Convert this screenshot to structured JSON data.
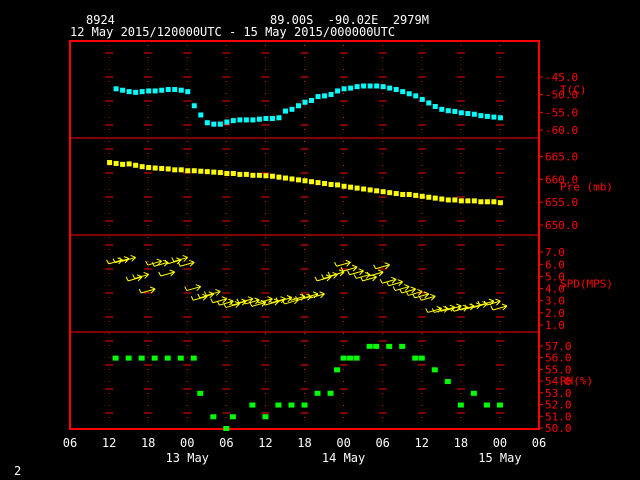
{
  "header": {
    "station": "8924",
    "location": "89.00S  -90.02E  2979M",
    "period": "12 May 2015/120000UTC - 15 May 2015/000000UTC"
  },
  "footer": {
    "page": "2"
  },
  "chart_data": {
    "type": "scatter",
    "x_hours": {
      "ticks": [
        -6,
        0,
        6,
        12,
        18,
        24,
        30,
        36,
        42,
        48,
        54,
        60,
        66,
        72,
        78
      ],
      "tick_labels": [
        "06",
        "12",
        "18",
        "00",
        "06",
        "12",
        "18",
        "00",
        "06",
        "12",
        "18",
        "00",
        "06"
      ],
      "tick_label_hours": [
        6,
        12,
        18,
        24,
        30,
        36,
        42,
        48,
        54,
        60,
        66,
        72,
        78
      ],
      "range": [
        6,
        78
      ],
      "origin_note_hidden": true
    },
    "date_labels": [
      {
        "text": "13 May",
        "hour": 24
      },
      {
        "text": "14 May",
        "hour": 48
      },
      {
        "text": "15 May",
        "hour": 72
      }
    ],
    "colors": {
      "frame": "#ff0000",
      "temp": "#00ffff",
      "pres": "#ffff00",
      "wind": "#ffff00",
      "rh": "#00ff00",
      "grid": "#ff0000",
      "text": "#ffffff"
    },
    "panels": [
      {
        "name": "T(C)",
        "label": "T(C)",
        "range": [
          -60.0,
          -45.0
        ],
        "ticks": [
          "-45.0",
          "-50.0",
          "-55.0",
          "-60.0"
        ],
        "tick_values": [
          -45,
          -50,
          -55,
          -60
        ],
        "series": {
          "hours": [
            13,
            14,
            15,
            16,
            17,
            18,
            19,
            20,
            21,
            22,
            23,
            24,
            25,
            26,
            27,
            28,
            29,
            30,
            31,
            32,
            33,
            34,
            35,
            36,
            37,
            38,
            39,
            40,
            41,
            42,
            43,
            44,
            45,
            46,
            47,
            48,
            49,
            50,
            51,
            52,
            53,
            54,
            55,
            56,
            57,
            58,
            59,
            60,
            61,
            62,
            63,
            64,
            65,
            66,
            67,
            68,
            69,
            70,
            71,
            72
          ],
          "values": [
            -48.2,
            -48.6,
            -49.0,
            -49.2,
            -49.0,
            -48.8,
            -48.8,
            -48.6,
            -48.4,
            -48.4,
            -48.6,
            -49.0,
            -53.0,
            -55.6,
            -57.8,
            -58.2,
            -58.2,
            -57.6,
            -57.2,
            -57.0,
            -57.0,
            -57.0,
            -56.8,
            -56.6,
            -56.6,
            -56.4,
            -54.5,
            -54.0,
            -53.0,
            -52.0,
            -51.5,
            -50.4,
            -50.2,
            -49.8,
            -48.8,
            -48.2,
            -48.0,
            -47.6,
            -47.4,
            -47.4,
            -47.4,
            -47.6,
            -48.0,
            -48.4,
            -49.0,
            -49.6,
            -50.2,
            -51.2,
            -52.2,
            -53.2,
            -54.0,
            -54.4,
            -54.6,
            -55.0,
            -55.2,
            -55.4,
            -55.8,
            -56.0,
            -56.2,
            -56.4
          ]
        }
      },
      {
        "name": "Pre (mb)",
        "label": "Pre (mb)",
        "range": [
          650.0,
          666.0
        ],
        "ticks": [
          "665.0",
          "660.0",
          "655.0",
          "650.0"
        ],
        "tick_values": [
          665,
          660,
          655,
          650
        ],
        "series": {
          "hours": [
            12,
            13,
            14,
            15,
            16,
            17,
            18,
            19,
            20,
            21,
            22,
            23,
            24,
            25,
            26,
            27,
            28,
            29,
            30,
            31,
            32,
            33,
            34,
            35,
            36,
            37,
            38,
            39,
            40,
            41,
            42,
            43,
            44,
            45,
            46,
            47,
            48,
            49,
            50,
            51,
            52,
            53,
            54,
            55,
            56,
            57,
            58,
            59,
            60,
            61,
            62,
            63,
            64,
            65,
            66,
            67,
            68,
            69,
            70,
            71,
            72
          ],
          "values": [
            663.8,
            663.6,
            663.4,
            663.5,
            663.2,
            662.9,
            662.7,
            662.6,
            662.5,
            662.4,
            662.2,
            662.2,
            662.0,
            662.0,
            661.9,
            661.8,
            661.7,
            661.6,
            661.4,
            661.4,
            661.2,
            661.2,
            661.0,
            661.0,
            660.9,
            660.8,
            660.6,
            660.4,
            660.2,
            660.0,
            659.8,
            659.6,
            659.4,
            659.2,
            659.0,
            658.9,
            658.6,
            658.4,
            658.2,
            658.0,
            657.8,
            657.6,
            657.4,
            657.2,
            657.0,
            656.8,
            656.8,
            656.6,
            656.4,
            656.2,
            656.0,
            655.8,
            655.6,
            655.6,
            655.4,
            655.4,
            655.4,
            655.2,
            655.2,
            655.2,
            655.0
          ]
        }
      },
      {
        "name": "SPD(MPS)",
        "label": "SPD(MPS)",
        "range": [
          1.0,
          8.0
        ],
        "ticks": [
          "7.0",
          "6.0",
          "5.0",
          "4.0",
          "3.0",
          "2.0",
          "1.0"
        ],
        "tick_values": [
          7,
          6,
          5,
          4,
          3,
          2,
          1
        ],
        "series": {
          "hours": [
            13,
            14,
            15,
            16,
            17,
            18,
            19,
            20,
            21,
            22,
            23,
            24,
            25,
            26,
            27,
            28,
            29,
            30,
            31,
            32,
            33,
            34,
            35,
            36,
            37,
            38,
            39,
            40,
            41,
            42,
            43,
            44,
            45,
            46,
            47,
            48,
            49,
            50,
            51,
            52,
            53,
            54,
            55,
            56,
            57,
            58,
            59,
            60,
            61,
            62,
            63,
            64,
            65,
            66,
            67,
            68,
            69,
            70,
            71,
            72
          ],
          "values": [
            6.2,
            6.3,
            6.4,
            4.8,
            5.0,
            3.8,
            6.1,
            6.0,
            5.2,
            6.2,
            6.4,
            6.0,
            4.0,
            3.2,
            3.4,
            3.6,
            3.0,
            2.8,
            2.6,
            2.8,
            3.0,
            2.9,
            2.7,
            3.0,
            2.8,
            3.0,
            3.1,
            2.9,
            3.2,
            3.2,
            3.4,
            3.4,
            4.8,
            5.0,
            5.2,
            6.0,
            5.6,
            5.3,
            5.0,
            4.8,
            5.2,
            5.8,
            4.6,
            4.4,
            4.0,
            3.8,
            3.6,
            3.4,
            3.2,
            2.2,
            2.2,
            2.3,
            2.4,
            2.3,
            2.4,
            2.5,
            2.6,
            2.8,
            2.8,
            2.4
          ]
        }
      },
      {
        "name": "RH(%)",
        "label": "RH(%)",
        "range": [
          50.0,
          57.5
        ],
        "ticks": [
          "57.0",
          "56.0",
          "55.0",
          "54.0",
          "53.0",
          "52.0",
          "51.0",
          "50.0"
        ],
        "tick_values": [
          57,
          56,
          55,
          54,
          53,
          52,
          51,
          50
        ],
        "series": {
          "hours": [
            13,
            15,
            17,
            19,
            21,
            23,
            25,
            26,
            28,
            30,
            31,
            34,
            36,
            38,
            40,
            42,
            44,
            46,
            47,
            48,
            49,
            50,
            52,
            53,
            55,
            57,
            59,
            60,
            62,
            64,
            66,
            68,
            70,
            72
          ],
          "values": [
            56,
            56,
            56,
            56,
            56,
            56,
            56,
            53,
            51,
            50,
            51,
            52,
            51,
            52,
            52,
            52,
            53,
            53,
            55,
            56,
            56,
            56,
            57,
            57,
            57,
            57,
            56,
            56,
            55,
            54,
            52,
            53,
            52,
            52
          ]
        }
      }
    ]
  }
}
